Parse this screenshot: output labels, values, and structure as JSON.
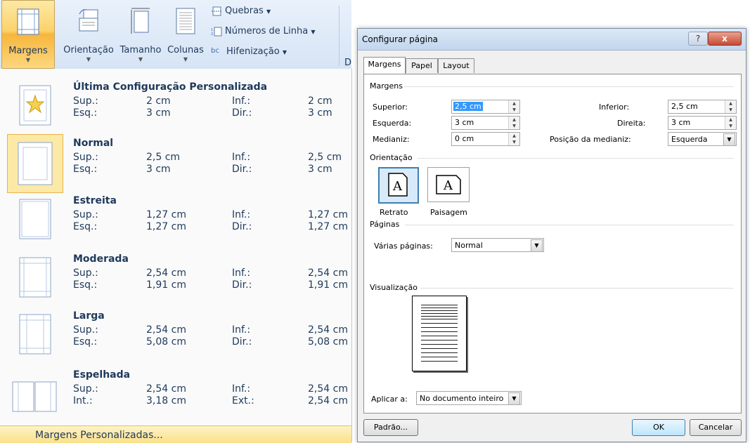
{
  "ribbon": {
    "margens": "Margens",
    "orientacao": "Orientação",
    "tamanho": "Tamanho",
    "colunas": "Colunas",
    "quebras": "Quebras",
    "numeros_linha": "Números de Linha",
    "hifenizacao": "Hifenização",
    "next_group_letter": "D"
  },
  "menu": {
    "items": [
      {
        "title": "Última Configuração Personalizada",
        "l1": "Sup.:",
        "v1": "2 cm",
        "l2": "Inf.:",
        "v2": "2 cm",
        "l3": "Esq.:",
        "v3": "3 cm",
        "l4": "Dir.:",
        "v4": "3 cm"
      },
      {
        "title": "Normal",
        "l1": "Sup.:",
        "v1": "2,5 cm",
        "l2": "Inf.:",
        "v2": "2,5 cm",
        "l3": "Esq.:",
        "v3": "3 cm",
        "l4": "Dir.:",
        "v4": "3 cm"
      },
      {
        "title": "Estreita",
        "l1": "Sup.:",
        "v1": "1,27 cm",
        "l2": "Inf.:",
        "v2": "1,27 cm",
        "l3": "Esq.:",
        "v3": "1,27 cm",
        "l4": "Dir.:",
        "v4": "1,27 cm"
      },
      {
        "title": "Moderada",
        "l1": "Sup.:",
        "v1": "2,54 cm",
        "l2": "Inf.:",
        "v2": "2,54 cm",
        "l3": "Esq.:",
        "v3": "1,91 cm",
        "l4": "Dir.:",
        "v4": "1,91 cm"
      },
      {
        "title": "Larga",
        "l1": "Sup.:",
        "v1": "2,54 cm",
        "l2": "Inf.:",
        "v2": "2,54 cm",
        "l3": "Esq.:",
        "v3": "5,08 cm",
        "l4": "Dir.:",
        "v4": "5,08 cm"
      },
      {
        "title": "Espelhada",
        "l1": "Sup.:",
        "v1": "2,54 cm",
        "l2": "Inf.:",
        "v2": "2,54 cm",
        "l3": "Int.:",
        "v3": "3,18 cm",
        "l4": "Ext.:",
        "v4": "2,54 cm"
      }
    ],
    "footer": "Margens Personalizadas..."
  },
  "dialog": {
    "title": "Configurar página",
    "help": "?",
    "close": "x",
    "tabs": [
      "Margens",
      "Papel",
      "Layout"
    ],
    "group_margens": "Margens",
    "superior_label": "Superior:",
    "superior_value": "2,5 cm",
    "inferior_label": "Inferior:",
    "inferior_value": "2,5 cm",
    "esquerda_label": "Esquerda:",
    "esquerda_value": "3 cm",
    "direita_label": "Direita:",
    "direita_value": "3 cm",
    "medianiz_label": "Medianiz:",
    "medianiz_value": "0 cm",
    "pos_medianiz_label": "Posição da medianiz:",
    "pos_medianiz_value": "Esquerda",
    "group_orientacao": "Orientação",
    "retrato": "Retrato",
    "paisagem": "Paisagem",
    "group_paginas": "Páginas",
    "varias_paginas_label": "Várias páginas:",
    "varias_paginas_value": "Normal",
    "group_visualizacao": "Visualização",
    "aplicar_label": "Aplicar a:",
    "aplicar_value": "No documento inteiro",
    "padrao": "Padrão...",
    "ok": "OK",
    "cancelar": "Cancelar"
  }
}
